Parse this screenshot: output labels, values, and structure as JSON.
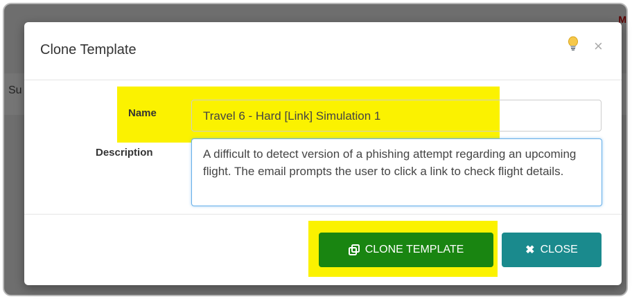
{
  "background": {
    "left_text": "Su",
    "top_right_text": "M"
  },
  "modal": {
    "title": "Clone Template",
    "hint_icon": "lightbulb-icon",
    "close_glyph": "×",
    "fields": {
      "name": {
        "label": "Name",
        "value": "Travel 6 - Hard [Link] Simulation 1"
      },
      "description": {
        "label": "Description",
        "value": "A difficult to detect version of a phishing attempt regarding an upcoming flight.  The email prompts the user to click a link to check flight details."
      }
    },
    "buttons": {
      "clone": {
        "label": "CLONE TEMPLATE",
        "icon": "clone-icon",
        "color": "#198511"
      },
      "close": {
        "label": "CLOSE",
        "icon": "times-icon",
        "color": "#1a8a8d"
      }
    },
    "highlight_color": "#fbf200"
  }
}
